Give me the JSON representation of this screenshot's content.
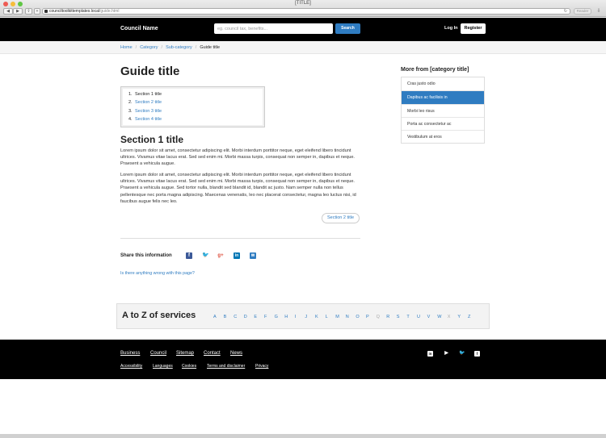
{
  "browser": {
    "window_title": "[TITLE]",
    "url_host": "counciltoolkittemplates.local",
    "url_path": "/guide.html",
    "reader_label": "Reader",
    "back_glyph": "◀",
    "forward_glyph": "▶",
    "share_glyph": "⇪",
    "add_glyph": "+",
    "reload_glyph": "↻",
    "download_glyph": "⇩"
  },
  "header": {
    "brand": "Council Name",
    "search_placeholder": "eg. council tax, benefits...",
    "search_button": "Search",
    "login": "Log In",
    "register": "Register"
  },
  "breadcrumb": {
    "sep": "/",
    "items": [
      "Home",
      "Category",
      "Sub-category"
    ],
    "current": "Guide title"
  },
  "guide": {
    "title": "Guide title",
    "toc": [
      {
        "num": "1.",
        "label": "Section 1 title"
      },
      {
        "num": "2.",
        "label": "Section 2 title"
      },
      {
        "num": "3.",
        "label": "Section 3 title"
      },
      {
        "num": "4.",
        "label": "Section 4 title"
      }
    ],
    "section_title": "Section 1 title",
    "para1": "Lorem ipsum dolor sit amet, consectetur adipiscing elit. Morbi interdum porttitor neque, eget eleifend libero tincidunt ultrices. Vivamus vitae lacus erat. Sed sed enim mi. Morbi massa turpis, consequat non semper in, dapibus et neque. Praesent a vehicula augue.",
    "para2": "Lorem ipsum dolor sit amet, consectetur adipiscing elit. Morbi interdum porttitor neque, eget eleifend libero tincidunt ultrices. Vivamus vitae lacus erat. Sed sed enim mi. Morbi massa turpis, consequat non semper in, dapibus et neque. Praesent a vehicula augue. Sed tortor nulla, blandit sed blandit id, blandit ac justo. Nam semper nulla non tellus pellentesque nec porta magna adipiscing. Maecenas venenatis, leo nec placerat consectetur, magna leo luctus nisi, id faucibus augue felis nec leo.",
    "next_button": "Section 2 title",
    "share_label": "Share this information",
    "share_icons": {
      "facebook": "f",
      "twitter": "🐦",
      "googleplus": "g+",
      "linkedin": "in",
      "email": "✉"
    },
    "report_link": "Is there anything wrong with this page?"
  },
  "sidebar": {
    "title": "More from [category title]",
    "items": [
      {
        "label": "Cras justo odio",
        "active": false
      },
      {
        "label": "Dapibus ac facilisis in",
        "active": true
      },
      {
        "label": "Morbi leo risus",
        "active": false
      },
      {
        "label": "Porta ac consectetur ac",
        "active": false
      },
      {
        "label": "Vestibulum at eros",
        "active": false
      }
    ]
  },
  "atoz": {
    "title": "A to Z of services",
    "letters": [
      {
        "l": "A",
        "on": true
      },
      {
        "l": "B",
        "on": true
      },
      {
        "l": "C",
        "on": true
      },
      {
        "l": "D",
        "on": true
      },
      {
        "l": "E",
        "on": true
      },
      {
        "l": "F",
        "on": true
      },
      {
        "l": "G",
        "on": true
      },
      {
        "l": "H",
        "on": true
      },
      {
        "l": "I",
        "on": true
      },
      {
        "l": "J",
        "on": true
      },
      {
        "l": "K",
        "on": true
      },
      {
        "l": "L",
        "on": true
      },
      {
        "l": "M",
        "on": true
      },
      {
        "l": "N",
        "on": true
      },
      {
        "l": "O",
        "on": true
      },
      {
        "l": "P",
        "on": true
      },
      {
        "l": "Q",
        "on": false
      },
      {
        "l": "R",
        "on": true
      },
      {
        "l": "S",
        "on": true
      },
      {
        "l": "T",
        "on": true
      },
      {
        "l": "U",
        "on": true
      },
      {
        "l": "V",
        "on": true
      },
      {
        "l": "W",
        "on": true
      },
      {
        "l": "X",
        "on": false
      },
      {
        "l": "Y",
        "on": true
      },
      {
        "l": "Z",
        "on": true
      }
    ]
  },
  "footer": {
    "main_links": [
      "Business",
      "Council",
      "Sitemap",
      "Contact",
      "News"
    ],
    "small_links": [
      "Accessibility",
      "Languages",
      "Cookies",
      "Terms and disclaimer",
      "Privacy"
    ],
    "social": {
      "linkedin": "in",
      "youtube": "▶",
      "twitter": "🐦",
      "facebook": "f"
    }
  },
  "colors": {
    "accent": "#2f7cc1",
    "header_bg": "#000000",
    "active_bg": "#2f7cc1"
  }
}
